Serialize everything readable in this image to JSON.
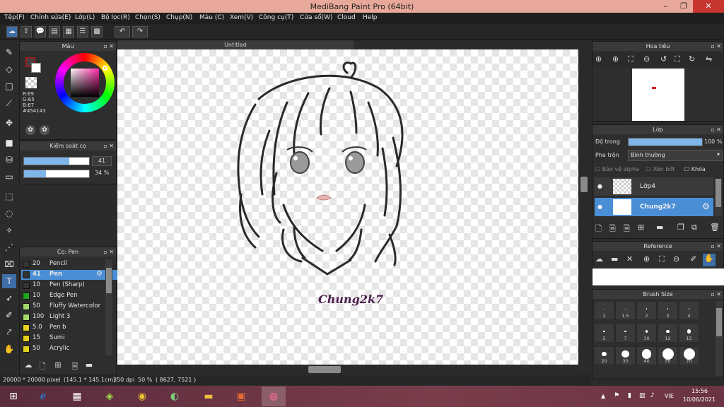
{
  "app": {
    "title": "MediBang Paint Pro (64bit)",
    "minimize": "–",
    "maximize": "❐",
    "close": "✕"
  },
  "menu": [
    "Tệp(F)",
    "Chỉnh sửa(E)",
    "Lớp(L)",
    "Bộ lọc(R)",
    "Chọn(S)",
    "Chụp(N)",
    "Màu (C)",
    "Xem(V)",
    "Công cụ(T)",
    "Cửa sổ(W)",
    "Cloud",
    "Help"
  ],
  "color_panel": {
    "title": "Màu",
    "r": "R:69",
    "g": "G:65",
    "b": "B:67",
    "hex": "#454143",
    "fg_color": "#454143",
    "accent_swatch": "#9c1c1c"
  },
  "brush_control": {
    "title": "Kiểm soát cọ",
    "size_value": "41",
    "opacity_value": "34 %",
    "size_fill": 0.7,
    "opacity_fill": 0.34
  },
  "brush_panel": {
    "title": "Cọ: Pen",
    "items": [
      {
        "size": "20",
        "name": "Pencil",
        "color": "#333333"
      },
      {
        "size": "41",
        "name": "Pen",
        "color": "#333333"
      },
      {
        "size": "10",
        "name": "Pen (Sharp)",
        "color": "#333333"
      },
      {
        "size": "10",
        "name": "Edge Pen",
        "color": "#1aa81a"
      },
      {
        "size": "50",
        "name": "Fluffy Watercolor",
        "color": "#a3d96b"
      },
      {
        "size": "100",
        "name": "Light 3",
        "color": "#a3d96b"
      },
      {
        "size": "5.0",
        "name": "Pen b",
        "color": "#e6d21c"
      },
      {
        "size": "15",
        "name": "Sumi",
        "color": "#e6d21c"
      },
      {
        "size": "50",
        "name": "Acrylic",
        "color": "#e6d21c"
      }
    ]
  },
  "canvas": {
    "tab_title": "Untitled",
    "signature": "Chung2k7"
  },
  "status": {
    "size": "20000 * 20000 pixel",
    "cm": "(145.1 * 145.1cm)",
    "dpi": "350 dpi",
    "zoom": "50 %",
    "coords": "( 8627, 7521 )"
  },
  "navigator": {
    "title": "Hoa tiêu"
  },
  "layers_panel": {
    "title": "Lớp",
    "opacity_label": "Độ trong",
    "opacity_value": "100 %",
    "blend_label": "Pha trộn",
    "blend_value": "Bình thường",
    "protect_alpha": "Bảo vệ alpha",
    "clipping": "Xén bớt",
    "lock": "Khóa",
    "layers": [
      {
        "name": "Lớp4"
      },
      {
        "name": "Chung2k7"
      }
    ]
  },
  "reference_panel": {
    "title": "Reference"
  },
  "brush_size_panel": {
    "title": "Brush Size",
    "labels": [
      "1",
      "1.5",
      "2",
      "3",
      "4",
      "5",
      "7",
      "10",
      "12",
      "15",
      "20",
      "30",
      "40",
      "50",
      "70"
    ]
  },
  "taskbar": {
    "time": "15:56",
    "date": "10/06/2021",
    "lang": "VIE"
  }
}
